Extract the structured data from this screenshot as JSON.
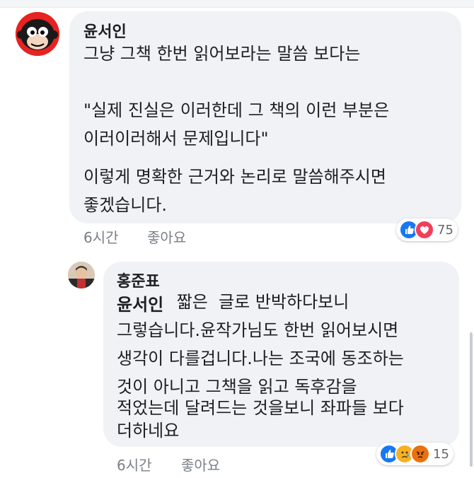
{
  "comments": [
    {
      "author": "윤서인",
      "lines": [
        "그냥 그책 한번 읽어보라는 말씀 보다는",
        "",
        "\"실제 진실은 이러한데 그 책의 이런 부분은",
        "이러이러해서 문제입니다\"",
        "",
        "이렇게 명확한 근거와 논리로 말씀해주시면",
        "좋겠습니다."
      ],
      "time": "6시간",
      "like_label": "좋아요",
      "reactions": {
        "icons": [
          "like-icon",
          "love-icon"
        ],
        "count": "75"
      }
    },
    {
      "author": "홍준표",
      "mention": "윤서인",
      "first_line_rest": " 짧은  글로 반박하다보니",
      "lines": [
        "그렇습니다.윤작가님도 한번 읽어보시면",
        "생각이 다를겁니다.나는 조국에 동조하는",
        "것이 아니고 그책을 읽고 독후감을",
        "적었는데 달려드는 것을보니 좌파들 보다",
        "더하네요"
      ],
      "time": "6시간",
      "like_label": "좋아요",
      "reactions": {
        "icons": [
          "like-icon",
          "sad-icon",
          "angry-icon"
        ],
        "count": "15"
      }
    }
  ],
  "colors": {
    "like": "#1877f2",
    "love": "#f33e58",
    "sad": "#f7b125",
    "angry": "#e9710f",
    "bubble": "#f0f2f5"
  }
}
